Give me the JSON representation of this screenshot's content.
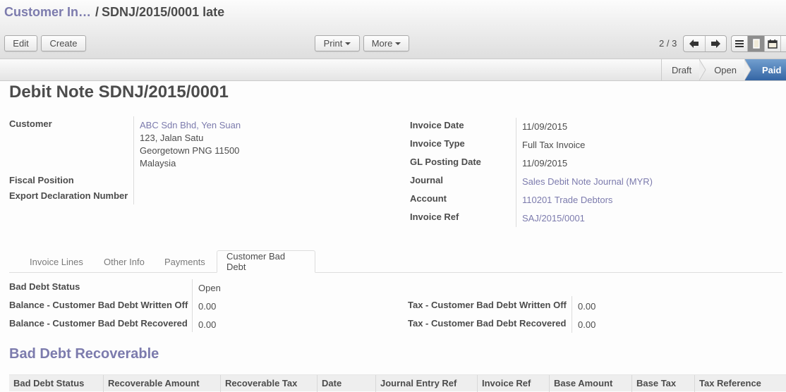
{
  "breadcrumb": {
    "parent": "Customer In…",
    "separator": "/",
    "current": "SDNJ/2015/0001 late"
  },
  "toolbar": {
    "edit_label": "Edit",
    "create_label": "Create",
    "print_label": "Print",
    "more_label": "More"
  },
  "pager": {
    "value": "2 / 3"
  },
  "view_switcher": {
    "views": [
      "list-icon",
      "form-icon",
      "calendar-icon"
    ],
    "active": "form-icon"
  },
  "statusbar": {
    "states": [
      "Draft",
      "Open",
      "Paid"
    ],
    "active": "Paid",
    "active_color": "#3465a4"
  },
  "form": {
    "title_prefix": "Debit Note",
    "title_number": "SDNJ/2015/0001",
    "left_fields": {
      "customer_label": "Customer",
      "customer_name": "ABC Sdn Bhd, Yen Suan",
      "address_lines": [
        "123, Jalan Satu",
        "Georgetown PNG 11500",
        "Malaysia"
      ],
      "fiscal_position_label": "Fiscal Position",
      "fiscal_position_value": "",
      "export_decl_label": "Export Declaration Number",
      "export_decl_value": ""
    },
    "right_fields": [
      {
        "label": "Invoice Date",
        "value": "11/09/2015",
        "is_link": false
      },
      {
        "label": "Invoice Type",
        "value": "Full Tax Invoice",
        "is_link": false
      },
      {
        "label": "GL Posting Date",
        "value": "11/09/2015",
        "is_link": false
      },
      {
        "label": "Journal",
        "value": "Sales Debit Note Journal (MYR)",
        "is_link": true
      },
      {
        "label": "Account",
        "value": "110201 Trade Debtors",
        "is_link": true
      },
      {
        "label": "Invoice Ref",
        "value": "SAJ/2015/0001",
        "is_link": true
      }
    ]
  },
  "tabs": [
    {
      "label": "Invoice Lines",
      "active": false
    },
    {
      "label": "Other Info",
      "active": false
    },
    {
      "label": "Payments",
      "active": false
    },
    {
      "label": "Customer Bad Debt",
      "active": true
    }
  ],
  "bad_debt": {
    "status_label": "Bad Debt Status",
    "status_value": "Open",
    "bal_written_off_label": "Balance - Customer Bad Debt Written Off",
    "bal_written_off_value": "0.00",
    "bal_recovered_label": "Balance - Customer Bad Debt Recovered",
    "bal_recovered_value": "0.00",
    "tax_written_off_label": "Tax - Customer Bad Debt Written Off",
    "tax_written_off_value": "0.00",
    "tax_recovered_label": "Tax - Customer Bad Debt Recovered",
    "tax_recovered_value": "0.00"
  },
  "recoverable": {
    "section_title": "Bad Debt Recoverable",
    "columns": [
      "Bad Debt Status",
      "Recoverable Amount",
      "Recoverable Tax",
      "Date",
      "Journal Entry Ref",
      "Invoice Ref",
      "Base Amount",
      "Base Tax",
      "Tax Reference"
    ]
  },
  "colors": {
    "link": "#7c7bad",
    "text": "#4c4c4c"
  }
}
